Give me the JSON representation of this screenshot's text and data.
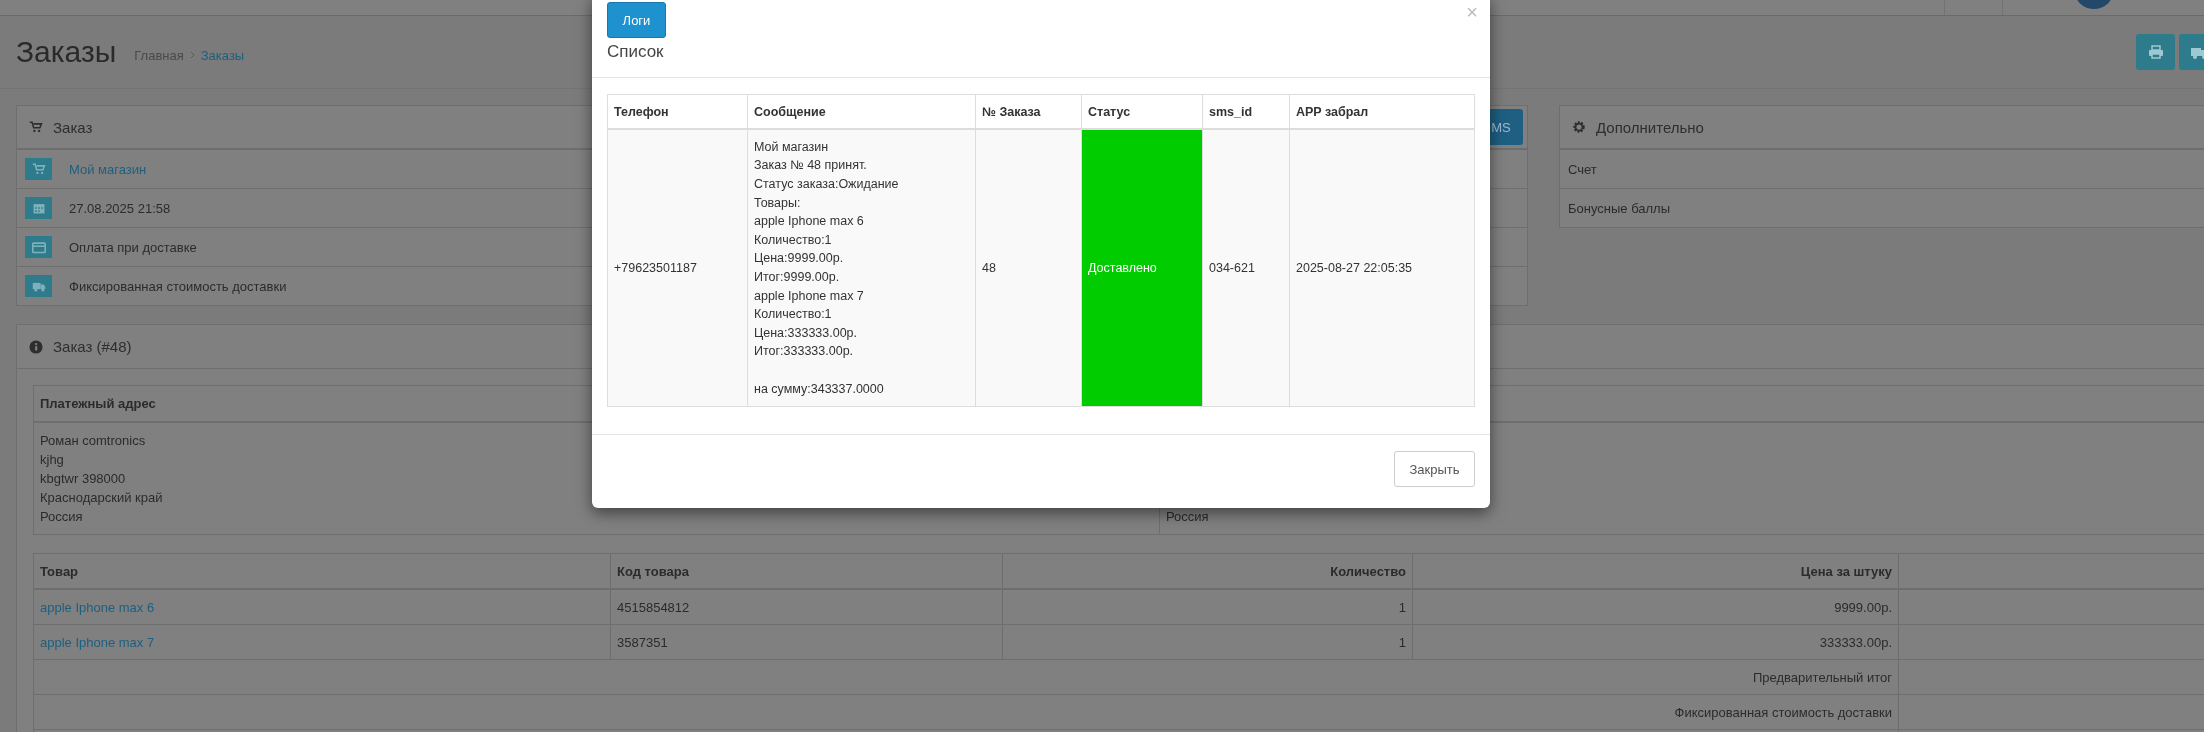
{
  "header": {
    "title": "Заказы",
    "breadcrumb": [
      {
        "label": "Главная",
        "link": false
      },
      {
        "label": "Заказы",
        "link": true
      }
    ]
  },
  "order_panel": {
    "title": "Заказ",
    "sms_button": "MS",
    "rows": [
      {
        "kind": "link",
        "text": "Мой магазин"
      },
      {
        "kind": "text",
        "text": "27.08.2025 21:58"
      },
      {
        "kind": "text",
        "text": "Оплата при доставке"
      },
      {
        "kind": "text",
        "text": "Фиксированная стоимость доставки"
      }
    ]
  },
  "extra_panel": {
    "title": "Дополнительно",
    "rows": [
      "Счет",
      "Бонусные баллы"
    ]
  },
  "details_panel": {
    "title": "Заказ (#48)",
    "payment_address": {
      "heading": "Платежный адрес",
      "lines": [
        "Роман comtronics",
        "kjhg",
        "kbgtwr 398000",
        "Краснодарский край",
        "Россия"
      ]
    },
    "shipping_address": {
      "lines": [
        "Россия"
      ]
    },
    "products": {
      "columns": [
        "Товар",
        "Код товара",
        "Количество",
        "Цена за штуку"
      ],
      "rows": [
        {
          "product": "apple Iphone max 6",
          "code": "4515854812",
          "quantity": "1",
          "price": "9999.00р."
        },
        {
          "product": "apple Iphone max 7",
          "code": "3587351",
          "quantity": "1",
          "price": "333333.00р."
        }
      ],
      "totals": [
        "Предварительный итог",
        "Фиксированная стоимость доставки"
      ]
    }
  },
  "modal": {
    "logs_button": "Логи",
    "title": "Список",
    "close": "×",
    "columns": [
      "Телефон",
      "Сообщение",
      "№ Заказа",
      "Статус",
      "sms_id",
      "APP забрал"
    ],
    "rows": [
      {
        "phone": "+79623501187",
        "message": "Мой магазин\nЗаказ № 48 принят.\nСтатус заказа:Ожидание\nТовары:\napple Iphone max 6\nКоличество:1\nЦена:9999.00р.\nИтог:9999.00р.\napple Iphone max 7\nКоличество:1\nЦена:333333.00р.\nИтог:333333.00р.\n\nна сумму:343337.0000",
        "order": "48",
        "status": {
          "text": "Доставлено",
          "color": "#00cc00"
        },
        "sms_id": "034-621",
        "app_taken": "2025-08-27 22:05:35"
      }
    ],
    "close_button": "Закрыть"
  }
}
